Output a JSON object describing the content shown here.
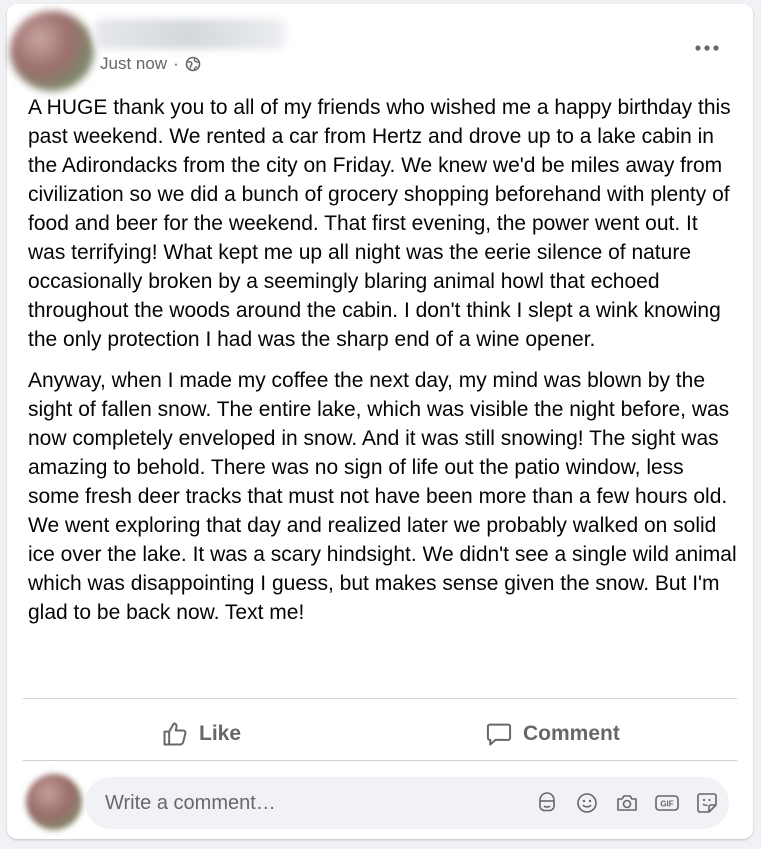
{
  "post": {
    "timestamp": "Just now",
    "separator": "·",
    "audience_icon": "globe-icon",
    "paragraphs": [
      "A HUGE thank you to all of my friends who wished me a happy birthday this past weekend. We rented a car from Hertz and drove up to a lake cabin in the Adirondacks from the city on Friday. We knew we'd be miles away from civilization so we did a bunch of grocery shopping beforehand with plenty of food and beer for the weekend. That first evening, the power went out. It was terrifying! What kept me up all night was the eerie silence of nature occasionally broken by a seemingly blaring animal howl that echoed throughout the woods around the cabin. I don't think I slept a wink knowing the only protection I had was the sharp end of a wine opener.",
      "Anyway, when I made my coffee the next day, my mind was blown by the sight of fallen snow. The entire lake, which was visible the night before, was now completely enveloped in snow. And it was still snowing! The sight was amazing to behold. There was no sign of life out the patio window, less some fresh deer tracks that must not have been more than a few hours old. We went exploring that day and realized later we probably walked on solid ice over the lake. It was a scary hindsight. We didn't see a single wild animal which was disappointing I guess, but makes sense given the snow. But I'm glad to be back now. Text me!"
    ]
  },
  "actions": {
    "like_label": "Like",
    "comment_label": "Comment"
  },
  "comment": {
    "placeholder": "Write a comment…",
    "value": "",
    "tools": [
      "avatar-sticker-icon",
      "emoji-icon",
      "camera-icon",
      "gif-icon",
      "sticker-icon"
    ]
  },
  "colors": {
    "text": "#050505",
    "secondary_text": "#65676b",
    "divider": "#ced0d4",
    "input_bg": "#f0f2f5"
  }
}
